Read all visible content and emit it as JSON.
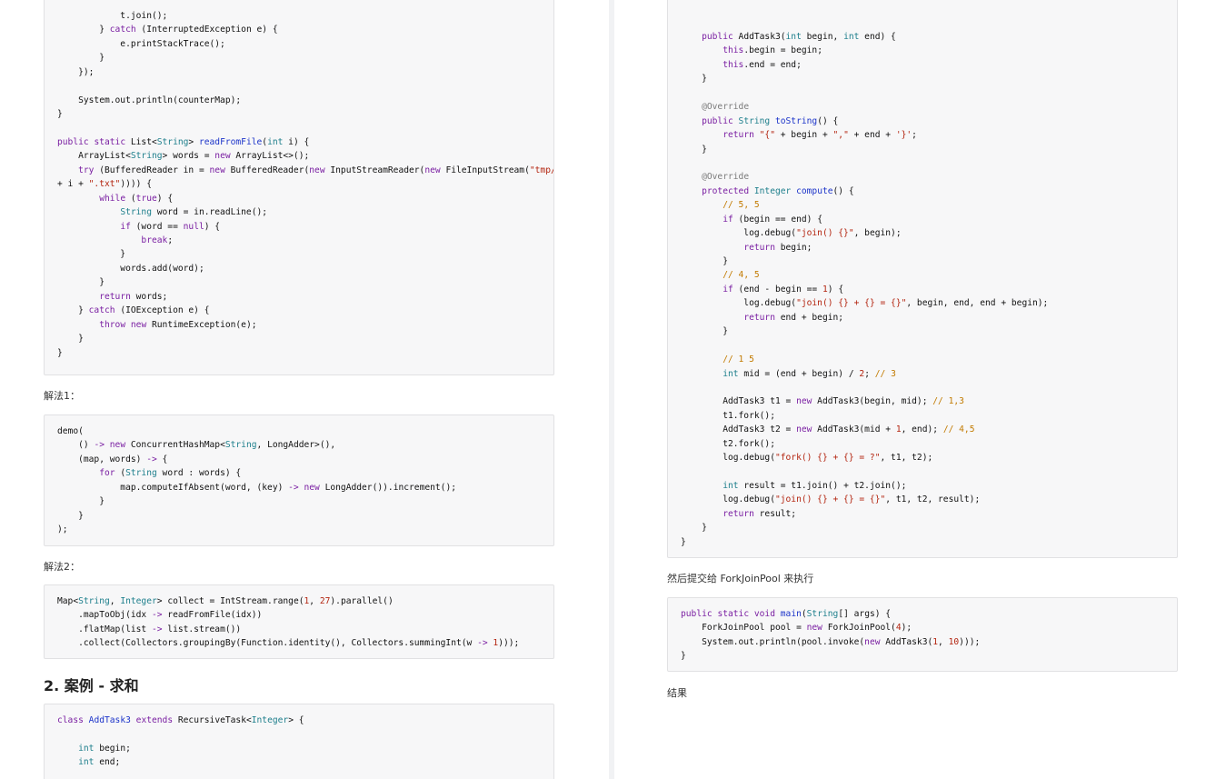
{
  "left": {
    "block1_lines": [
      "            t.join();",
      "        } catch (InterruptedException e) {",
      "            e.printStackTrace();",
      "        }",
      "    });",
      "",
      "    System.out.println(counterMap);",
      "}",
      "",
      "public static List<String> readFromFile(int i) {",
      "    ArrayList<String> words = new ArrayList<>();",
      "    try (BufferedReader in = new BufferedReader(new InputStreamReader(new FileInputStream(\"tmp/\"",
      "+ i + \".txt\")))) {",
      "        while (true) {",
      "            String word = in.readLine();",
      "            if (word == null) {",
      "                break;",
      "            }",
      "            words.add(word);",
      "        }",
      "        return words;",
      "    } catch (IOException e) {",
      "        throw new RuntimeException(e);",
      "    }",
      "}"
    ],
    "label_solution1": "解法1：",
    "block2_lines": [
      "demo(",
      "    () -> new ConcurrentHashMap<String, LongAdder>(),",
      "    (map, words) -> {",
      "        for (String word : words) {",
      "            map.computeIfAbsent(word, (key) -> new LongAdder()).increment();",
      "        }",
      "    }",
      ");"
    ],
    "label_solution2": "解法2：",
    "block3_lines": [
      "Map<String, Integer> collect = IntStream.range(1, 27).parallel()",
      "    .mapToObj(idx -> readFromFile(idx))",
      "    .flatMap(list -> list.stream())",
      "    .collect(Collectors.groupingBy(Function.identity(), Collectors.summingInt(w -> 1)));"
    ],
    "heading": "2. 案例 - 求和",
    "block4_lines": [
      "class AddTask3 extends RecursiveTask<Integer> {",
      "",
      "    int begin;",
      "    int end;"
    ]
  },
  "right": {
    "block1_lines": [
      "    public AddTask3(int begin, int end) {",
      "        this.begin = begin;",
      "        this.end = end;",
      "    }",
      "",
      "    @Override",
      "    public String toString() {",
      "        return \"{\" + begin + \",\" + end + '}';",
      "    }",
      "",
      "    @Override",
      "    protected Integer compute() {",
      "        // 5, 5",
      "        if (begin == end) {",
      "            log.debug(\"join() {}\", begin);",
      "            return begin;",
      "        }",
      "        // 4, 5",
      "        if (end - begin == 1) {",
      "            log.debug(\"join() {} + {} = {}\", begin, end, end + begin);",
      "            return end + begin;",
      "        }",
      "",
      "        // 1 5",
      "        int mid = (end + begin) / 2; // 3",
      "",
      "        AddTask3 t1 = new AddTask3(begin, mid); // 1,3",
      "        t1.fork();",
      "        AddTask3 t2 = new AddTask3(mid + 1, end); // 4,5",
      "        t2.fork();",
      "        log.debug(\"fork() {} + {} = ?\", t1, t2);",
      "",
      "        int result = t1.join() + t2.join();",
      "        log.debug(\"join() {} + {} = {}\", t1, t2, result);",
      "        return result;",
      "    }",
      "}"
    ],
    "label_submit": "然后提交给 ForkJoinPool 来执行",
    "block2_lines": [
      "public static void main(String[] args) {",
      "    ForkJoinPool pool = new ForkJoinPool(4);",
      "    System.out.println(pool.invoke(new AddTask3(1, 10)));",
      "}"
    ],
    "label_result": "结果"
  }
}
